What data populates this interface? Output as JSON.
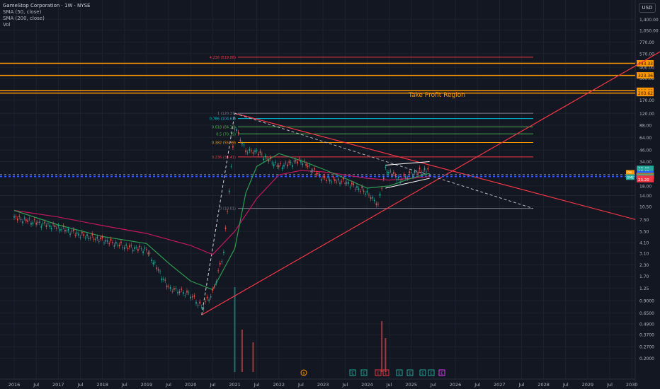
{
  "header": {
    "title": "GameStop Corporation · 1W · NYSE",
    "indicators": [
      "SMA (50, close)",
      "SMA (200, close)",
      "Vol"
    ],
    "currency": "USD"
  },
  "annotations": {
    "take_profit": "Take Profit Region",
    "event_markers": [
      "$",
      "E",
      "E",
      "E",
      "E",
      "E",
      "E",
      "E",
      "E",
      "E",
      "E",
      "E"
    ],
    "ticker_badge": "GME",
    "pre_badge": "Pre"
  },
  "colors": {
    "background": "#131722",
    "up": "#26a69a",
    "down": "#ef5350",
    "sma50": "#2e9b52",
    "sma200": "#c2185b",
    "trendline": "#f23645",
    "orange": "#ff9800"
  },
  "chart_data": {
    "type": "candlestick",
    "title": "GameStop Corporation · 1W · NYSE",
    "y_scale": "log",
    "ylim": [
      0.15,
      2000
    ],
    "y_ticks": [
      "1,400.00",
      "1,050.00",
      "770.00",
      "570.00",
      "400.00",
      "300.00",
      "170.00",
      "120.00",
      "88.00",
      "64.00",
      "46.00",
      "34.00",
      "18.00",
      "14.00",
      "10.50",
      "7.50",
      "5.50",
      "4.10",
      "3.10",
      "2.30",
      "1.70",
      "1.25",
      "0.9000",
      "0.6500",
      "0.4900",
      "0.3700",
      "0.2700",
      "0.2000"
    ],
    "x_ticks": [
      "2016",
      "Jul",
      "2017",
      "Jul",
      "2018",
      "Jul",
      "2019",
      "Jul",
      "2020",
      "Jul",
      "2021",
      "Jul",
      "2022",
      "Jul",
      "2023",
      "Jul",
      "2024",
      "Jul",
      "2025",
      "Jul",
      "2026",
      "Jul",
      "2027",
      "Jul",
      "2028",
      "Jul",
      "2029",
      "Jul",
      "2030"
    ],
    "price_points": [
      [
        "2016-01",
        7.9
      ],
      [
        "2016-07",
        6.9
      ],
      [
        "2017-01",
        6.1
      ],
      [
        "2017-07",
        5.0
      ],
      [
        "2018-01",
        4.4
      ],
      [
        "2018-07",
        3.7
      ],
      [
        "2019-01",
        3.4
      ],
      [
        "2019-07",
        1.25
      ],
      [
        "2019-10",
        1.15
      ],
      [
        "2020-01",
        1.05
      ],
      [
        "2020-04",
        0.75
      ],
      [
        "2020-07",
        1.1
      ],
      [
        "2020-10",
        3.2
      ],
      [
        "2021-01",
        85
      ],
      [
        "2021-04",
        45
      ],
      [
        "2021-07",
        44
      ],
      [
        "2022-01",
        30
      ],
      [
        "2022-07",
        35
      ],
      [
        "2023-01",
        22
      ],
      [
        "2023-07",
        20
      ],
      [
        "2024-01",
        15
      ],
      [
        "2024-04",
        11
      ],
      [
        "2024-06",
        28
      ],
      [
        "2024-10",
        21
      ],
      [
        "2025-01",
        25
      ],
      [
        "2025-06",
        28
      ]
    ],
    "sma50": [
      [
        "2016-01",
        9.5
      ],
      [
        "2017-01",
        6.5
      ],
      [
        "2018-01",
        4.8
      ],
      [
        "2019-01",
        4.0
      ],
      [
        "2019-07",
        2.4
      ],
      [
        "2020-01",
        1.5
      ],
      [
        "2020-07",
        1.2
      ],
      [
        "2021-01",
        3.5
      ],
      [
        "2021-04",
        15
      ],
      [
        "2021-07",
        30
      ],
      [
        "2022-01",
        42
      ],
      [
        "2022-07",
        35
      ],
      [
        "2023-01",
        28
      ],
      [
        "2023-07",
        22
      ],
      [
        "2024-01",
        17
      ],
      [
        "2024-07",
        18
      ],
      [
        "2025-01",
        22
      ],
      [
        "2025-06",
        25
      ]
    ],
    "sma200": [
      [
        "2016-01",
        9.5
      ],
      [
        "2017-01",
        8.0
      ],
      [
        "2018-01",
        6.4
      ],
      [
        "2019-01",
        5.2
      ],
      [
        "2020-01",
        3.8
      ],
      [
        "2020-07",
        3.0
      ],
      [
        "2021-01",
        5.5
      ],
      [
        "2021-07",
        13
      ],
      [
        "2022-01",
        24
      ],
      [
        "2022-07",
        27
      ],
      [
        "2023-01",
        26
      ],
      [
        "2023-07",
        24
      ],
      [
        "2024-01",
        22
      ],
      [
        "2024-07",
        21
      ],
      [
        "2025-01",
        22
      ],
      [
        "2025-06",
        23
      ]
    ],
    "volume_spikes": [
      [
        "2021-01",
        1.0
      ],
      [
        "2021-03",
        0.5
      ],
      [
        "2021-06",
        0.35
      ],
      [
        "2024-05",
        0.6
      ],
      [
        "2024-06",
        0.4
      ]
    ],
    "fib_levels": [
      {
        "label": "4.236 (519.88)",
        "price": 519.88
      },
      {
        "label": "1 (120.37)",
        "price": 120.37
      },
      {
        "label": "0.786 (104.61)",
        "price": 104.61
      },
      {
        "label": "0.618 (84.19)",
        "price": 84.19
      },
      {
        "label": "0.5 (70.19)",
        "price": 70.19
      },
      {
        "label": "0.382 (55.99)",
        "price": 55.99
      },
      {
        "label": "0.236 (38.41)",
        "price": 38.41
      },
      {
        "label": "0 (10.01)",
        "price": 10.01
      }
    ],
    "orange_levels": [
      {
        "label": "443.33",
        "price": 443.33
      },
      {
        "label": "323.36",
        "price": 323.36
      },
      {
        "label": "216.63",
        "price": 216.63
      },
      {
        "label": "203.62",
        "price": 203.62
      }
    ],
    "price_tags": [
      {
        "label": "28.40",
        "price": 28.4,
        "color": "#26a69a"
      },
      {
        "label": "28.40",
        "price": 26.5,
        "color": "#26a69a"
      },
      {
        "label": "24.76",
        "price": 24.76,
        "color": "#2962ff"
      },
      {
        "label": "24.28",
        "price": 24.28,
        "color": "#2962ff"
      },
      {
        "label": "23.92",
        "price": 23.92,
        "color": "#2962ff"
      },
      {
        "label": "23.92",
        "price": 23.4,
        "color": "#131722"
      },
      {
        "label": "23.43",
        "price": 23.1,
        "color": "#ff9800"
      },
      {
        "label": "23.33",
        "price": 22.7,
        "color": "#26a69a"
      },
      {
        "label": "23.20",
        "price": 22.0,
        "color": "#f23645"
      },
      {
        "label": "23.20",
        "price": 21.3,
        "color": "#f23645"
      }
    ]
  }
}
